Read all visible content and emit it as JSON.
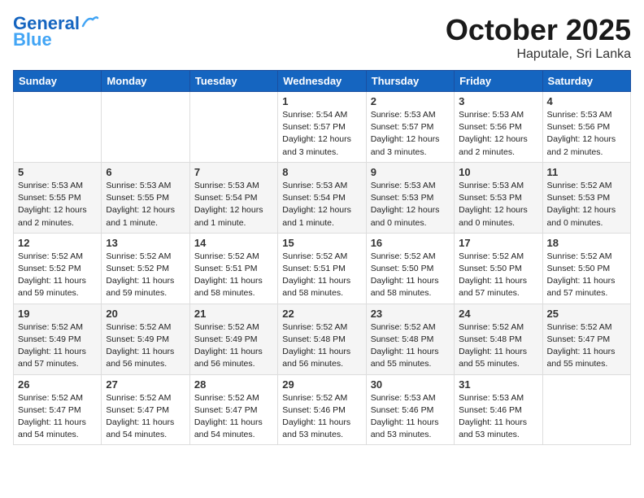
{
  "header": {
    "logo_line1": "General",
    "logo_line2": "Blue",
    "month": "October 2025",
    "location": "Haputale, Sri Lanka"
  },
  "weekdays": [
    "Sunday",
    "Monday",
    "Tuesday",
    "Wednesday",
    "Thursday",
    "Friday",
    "Saturday"
  ],
  "weeks": [
    [
      {
        "day": "",
        "info": ""
      },
      {
        "day": "",
        "info": ""
      },
      {
        "day": "",
        "info": ""
      },
      {
        "day": "1",
        "info": "Sunrise: 5:54 AM\nSunset: 5:57 PM\nDaylight: 12 hours\nand 3 minutes."
      },
      {
        "day": "2",
        "info": "Sunrise: 5:53 AM\nSunset: 5:57 PM\nDaylight: 12 hours\nand 3 minutes."
      },
      {
        "day": "3",
        "info": "Sunrise: 5:53 AM\nSunset: 5:56 PM\nDaylight: 12 hours\nand 2 minutes."
      },
      {
        "day": "4",
        "info": "Sunrise: 5:53 AM\nSunset: 5:56 PM\nDaylight: 12 hours\nand 2 minutes."
      }
    ],
    [
      {
        "day": "5",
        "info": "Sunrise: 5:53 AM\nSunset: 5:55 PM\nDaylight: 12 hours\nand 2 minutes."
      },
      {
        "day": "6",
        "info": "Sunrise: 5:53 AM\nSunset: 5:55 PM\nDaylight: 12 hours\nand 1 minute."
      },
      {
        "day": "7",
        "info": "Sunrise: 5:53 AM\nSunset: 5:54 PM\nDaylight: 12 hours\nand 1 minute."
      },
      {
        "day": "8",
        "info": "Sunrise: 5:53 AM\nSunset: 5:54 PM\nDaylight: 12 hours\nand 1 minute."
      },
      {
        "day": "9",
        "info": "Sunrise: 5:53 AM\nSunset: 5:53 PM\nDaylight: 12 hours\nand 0 minutes."
      },
      {
        "day": "10",
        "info": "Sunrise: 5:53 AM\nSunset: 5:53 PM\nDaylight: 12 hours\nand 0 minutes."
      },
      {
        "day": "11",
        "info": "Sunrise: 5:52 AM\nSunset: 5:53 PM\nDaylight: 12 hours\nand 0 minutes."
      }
    ],
    [
      {
        "day": "12",
        "info": "Sunrise: 5:52 AM\nSunset: 5:52 PM\nDaylight: 11 hours\nand 59 minutes."
      },
      {
        "day": "13",
        "info": "Sunrise: 5:52 AM\nSunset: 5:52 PM\nDaylight: 11 hours\nand 59 minutes."
      },
      {
        "day": "14",
        "info": "Sunrise: 5:52 AM\nSunset: 5:51 PM\nDaylight: 11 hours\nand 58 minutes."
      },
      {
        "day": "15",
        "info": "Sunrise: 5:52 AM\nSunset: 5:51 PM\nDaylight: 11 hours\nand 58 minutes."
      },
      {
        "day": "16",
        "info": "Sunrise: 5:52 AM\nSunset: 5:50 PM\nDaylight: 11 hours\nand 58 minutes."
      },
      {
        "day": "17",
        "info": "Sunrise: 5:52 AM\nSunset: 5:50 PM\nDaylight: 11 hours\nand 57 minutes."
      },
      {
        "day": "18",
        "info": "Sunrise: 5:52 AM\nSunset: 5:50 PM\nDaylight: 11 hours\nand 57 minutes."
      }
    ],
    [
      {
        "day": "19",
        "info": "Sunrise: 5:52 AM\nSunset: 5:49 PM\nDaylight: 11 hours\nand 57 minutes."
      },
      {
        "day": "20",
        "info": "Sunrise: 5:52 AM\nSunset: 5:49 PM\nDaylight: 11 hours\nand 56 minutes."
      },
      {
        "day": "21",
        "info": "Sunrise: 5:52 AM\nSunset: 5:49 PM\nDaylight: 11 hours\nand 56 minutes."
      },
      {
        "day": "22",
        "info": "Sunrise: 5:52 AM\nSunset: 5:48 PM\nDaylight: 11 hours\nand 56 minutes."
      },
      {
        "day": "23",
        "info": "Sunrise: 5:52 AM\nSunset: 5:48 PM\nDaylight: 11 hours\nand 55 minutes."
      },
      {
        "day": "24",
        "info": "Sunrise: 5:52 AM\nSunset: 5:48 PM\nDaylight: 11 hours\nand 55 minutes."
      },
      {
        "day": "25",
        "info": "Sunrise: 5:52 AM\nSunset: 5:47 PM\nDaylight: 11 hours\nand 55 minutes."
      }
    ],
    [
      {
        "day": "26",
        "info": "Sunrise: 5:52 AM\nSunset: 5:47 PM\nDaylight: 11 hours\nand 54 minutes."
      },
      {
        "day": "27",
        "info": "Sunrise: 5:52 AM\nSunset: 5:47 PM\nDaylight: 11 hours\nand 54 minutes."
      },
      {
        "day": "28",
        "info": "Sunrise: 5:52 AM\nSunset: 5:47 PM\nDaylight: 11 hours\nand 54 minutes."
      },
      {
        "day": "29",
        "info": "Sunrise: 5:52 AM\nSunset: 5:46 PM\nDaylight: 11 hours\nand 53 minutes."
      },
      {
        "day": "30",
        "info": "Sunrise: 5:53 AM\nSunset: 5:46 PM\nDaylight: 11 hours\nand 53 minutes."
      },
      {
        "day": "31",
        "info": "Sunrise: 5:53 AM\nSunset: 5:46 PM\nDaylight: 11 hours\nand 53 minutes."
      },
      {
        "day": "",
        "info": ""
      }
    ]
  ]
}
